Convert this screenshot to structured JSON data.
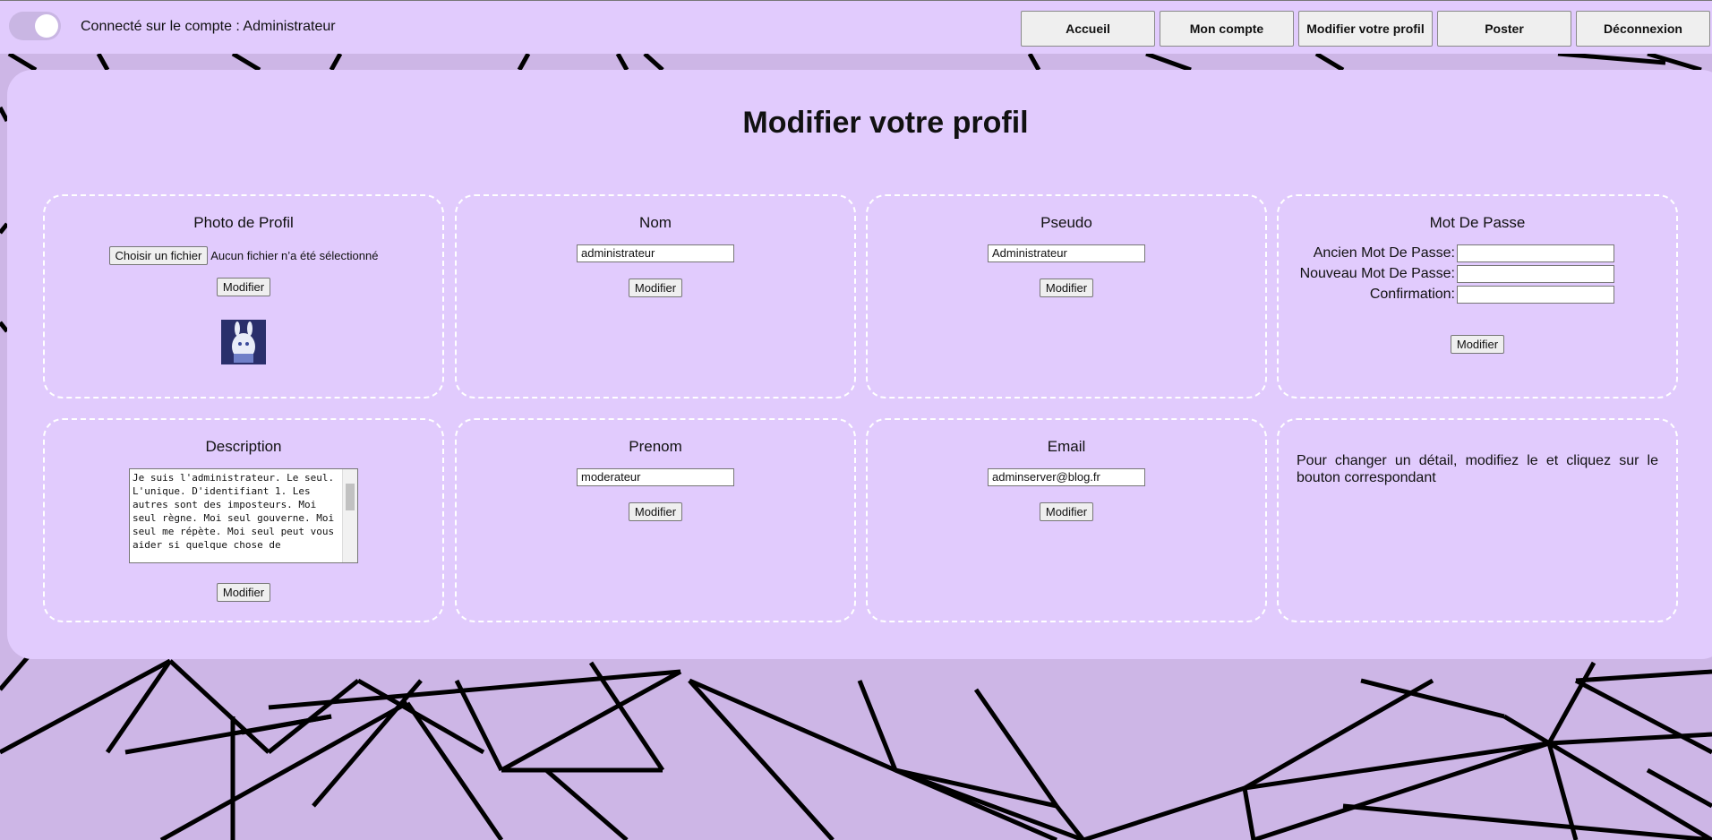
{
  "header": {
    "account_label": "Connecté sur le compte : Administrateur",
    "nav": [
      "Accueil",
      "Mon compte",
      "Modifier votre profil",
      "Poster",
      "Déconnexion"
    ]
  },
  "page_title": "Modifier votre profil",
  "photo": {
    "title": "Photo de Profil",
    "choose_file": "Choisir un fichier",
    "no_file": "Aucun fichier n’a été sélectionné",
    "modify": "Modifier"
  },
  "nom": {
    "title": "Nom",
    "value": "administrateur",
    "modify": "Modifier"
  },
  "pseudo": {
    "title": "Pseudo",
    "value": "Administrateur",
    "modify": "Modifier"
  },
  "password": {
    "title": "Mot De Passe",
    "old_label": "Ancien Mot De Passe:",
    "new_label": "Nouveau Mot De Passe:",
    "confirm_label": "Confirmation:",
    "modify": "Modifier"
  },
  "description": {
    "title": "Description",
    "value": "Je suis l'administrateur. Le seul. L'unique. D'identifiant 1. Les autres sont des imposteurs. Moi seul règne. Moi seul gouverne. Moi seul me répète. Moi seul peut vous aider si quelque chose de",
    "modify": "Modifier"
  },
  "prenom": {
    "title": "Prenom",
    "value": "moderateur",
    "modify": "Modifier"
  },
  "email": {
    "title": "Email",
    "value": "adminserver@blog.fr",
    "modify": "Modifier"
  },
  "info": {
    "text": "Pour changer un détail, modifiez le et cliquez sur le bouton correspondant"
  },
  "colors": {
    "accent": "#e1cbfd",
    "background": "#cdb6e6"
  }
}
